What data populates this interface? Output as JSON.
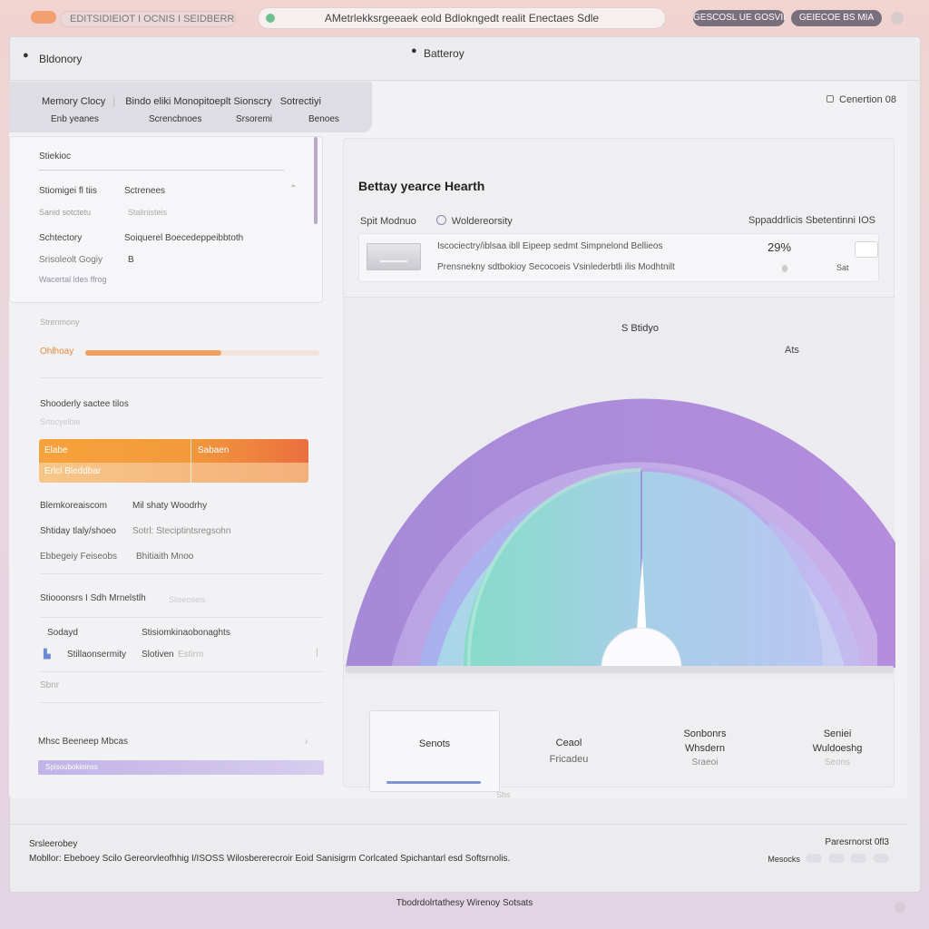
{
  "browser": {
    "top_chip": "EDITSIDIEIOT I OCNIS I SEIDBERRAST",
    "url": "AMetrlekksrgeeaek eold Bdlokngedt realit Enectaes Sdle",
    "button1": "GESCOSL UE GOSVIB",
    "button2": "GEIECOE BS MIA"
  },
  "window": {
    "left_title": "Bldonory",
    "center_title": "Batteroy"
  },
  "tabs": {
    "row1": [
      "Memory Clocy",
      "Bindo eliki Monopitoeplt Sionscry",
      "Sotrectiyi"
    ],
    "row2": [
      "Enb yeanes",
      "Screncbnoes",
      "Srsoremi",
      "Benoes"
    ],
    "cycle": "Cenertion 08"
  },
  "left": {
    "section1_title": "Stiekioc",
    "row1_label": "Stiomigei fl tiis",
    "row1_value": "Sctrenees",
    "row2_label": "Sanid sotctetu",
    "row2_value": "Stalinisteis",
    "row3_label": "Schtectory",
    "row3_value": "Soiquerel Boecedeppeibbtoth",
    "row4_label": "Srisoleolt Gogiy",
    "row4_value": "B",
    "row5_label": "Wacertal ldes ffrog",
    "section2_small": "Strenmony",
    "progress_label": "Ohlhoay",
    "progress_percent": 58,
    "section3_title": "Shooderly sactee tilos",
    "section3_small": "Srtocyelbie",
    "orange_left": "Elabe",
    "orange_right": "Sabaen",
    "orange_bottom": "Erlcl Bleddbar",
    "stat1_label": "Blemkoreaiscom",
    "stat1_value": "Mil shaty Woodrhy",
    "stat2_label": "Shtiday tlaly/shoeo",
    "stat2_value": "Sotrl: Steciptintsregsohn",
    "stat3_label": "Ebbegeiy Feiseobs",
    "stat3_value": "Bhitiaith Mnoo",
    "section4_title": "Stiooonsrs I Sdh Mrnelstlh",
    "section4_small": "Sliseoseis",
    "row6_label": "Sodayd",
    "row6_value": "Stisiomkinaobonaghts",
    "row7_label": "Stillaonsermity",
    "row7_value": "Slotiven",
    "row7_extra": "Estirm",
    "row8_label": "Sbnr",
    "section5_title": "Mhsc Beeneep Mbcas",
    "lavender_label": "Spisoubokioinss"
  },
  "main": {
    "title": "Bettay yearce Hearth",
    "row_label": "Spit Modnuo",
    "row_toggle": "Woldereorsity",
    "row_right": "Sppaddrlicis Sbetentinni IOS",
    "detail_line1": "Iscociectry/iblsaa ibll Eipeep sedmt Simpnelond Bellieos",
    "detail_line2": "Prensnekny sdtbokioy Secocoeis Vsinlederbtli ilis Modhtnilt",
    "detail_pct": "29%",
    "detail_small": "Sat",
    "gauge_label": "S Btidyo",
    "gauge_value": "Ats",
    "gauge_level": 0.5
  },
  "stats": [
    {
      "line1": "Senots",
      "line2": ""
    },
    {
      "line1": "Ceaol",
      "line2": "Fricadeu"
    },
    {
      "line1": "Sonbonrs",
      "line2": "Whsdern",
      "sub": "Sraeoi"
    },
    {
      "line1": "Seniei",
      "line2": "Wuldoeshg",
      "sub": "Seons"
    }
  ],
  "stat_foot": "Sbs",
  "footer": {
    "title": "Srsleerobey",
    "text": "Mobllor: Ebeboey Scilo Gereorvleofhhig I/ISOSS Wilosbererecroir Eoid Sanisigrm Corlcated Spichantarl esd Softsrnolis.",
    "right": "Paresrnorst 0fl3",
    "pages_label": "Mesocks"
  },
  "status_bar": "Tbodrdolrtathesy Wirenoy Sotsats",
  "colors": {
    "orange": "#f29a3c",
    "purple_outer": "#a57ed6",
    "teal": "#7fdac8",
    "lavender": "#c2b3e6"
  }
}
